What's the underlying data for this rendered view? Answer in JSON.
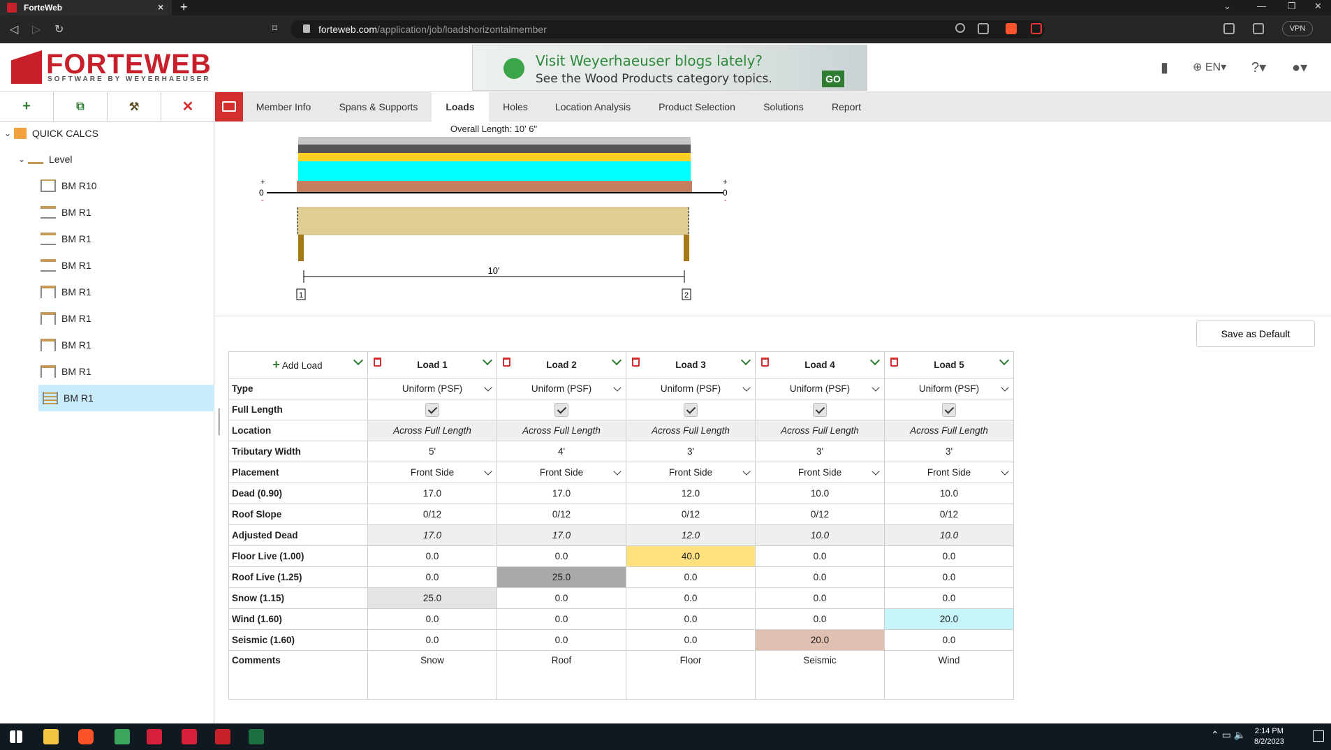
{
  "browser": {
    "tab_title": "ForteWeb",
    "url_domain": "forteweb.com",
    "url_path": "/application/job/loadshorizontalmember",
    "vpn_label": "VPN"
  },
  "header": {
    "logo_text": "FORTEWEB",
    "logo_sub": "SOFTWARE BY WEYERHAEUSER",
    "banner_line1": "Visit Weyerhaeuser blogs lately?",
    "banner_line2": "See the Wood Products category topics.",
    "banner_go": "GO",
    "lang": "EN"
  },
  "tree": {
    "root": "QUICK CALCS",
    "level": "Level",
    "items": [
      "BM R10",
      "BM R1",
      "BM R1",
      "BM R1",
      "BM R1",
      "BM R1",
      "BM R1",
      "BM R1",
      "BM R1"
    ]
  },
  "tabs": [
    "Member Info",
    "Spans & Supports",
    "Loads",
    "Holes",
    "Location Analysis",
    "Product Selection",
    "Solutions",
    "Report"
  ],
  "active_tab": "Loads",
  "diagram": {
    "overall_length": "Overall Length: 10' 6\"",
    "span_label": "10'",
    "support_1": "1",
    "support_2": "2",
    "zero_left": "0",
    "zero_right": "0",
    "plus": "+",
    "minus": "-",
    "load_bar_colors": [
      "#c6c6c6",
      "#555555",
      "#ffd024",
      "#00ffff",
      "#c4805e"
    ]
  },
  "save_default": "Save as Default",
  "grid": {
    "add_load": "Add Load",
    "loads": [
      "Load 1",
      "Load 2",
      "Load 3",
      "Load 4",
      "Load 5"
    ],
    "rows": {
      "type": {
        "label": "Type",
        "values": [
          "Uniform (PSF)",
          "Uniform (PSF)",
          "Uniform (PSF)",
          "Uniform (PSF)",
          "Uniform (PSF)"
        ]
      },
      "full_length": {
        "label": "Full Length"
      },
      "location": {
        "label": "Location",
        "values": [
          "Across Full Length",
          "Across Full Length",
          "Across Full Length",
          "Across Full Length",
          "Across Full Length"
        ]
      },
      "trib": {
        "label": "Tributary Width",
        "values": [
          "5'",
          "4'",
          "3'",
          "3'",
          "3'"
        ]
      },
      "placement": {
        "label": "Placement",
        "values": [
          "Front Side",
          "Front Side",
          "Front Side",
          "Front Side",
          "Front Side"
        ]
      },
      "dead": {
        "label": "Dead (0.90)",
        "values": [
          "17.0",
          "17.0",
          "12.0",
          "10.0",
          "10.0"
        ]
      },
      "roof_slope": {
        "label": "Roof Slope",
        "values": [
          "0/12",
          "0/12",
          "0/12",
          "0/12",
          "0/12"
        ]
      },
      "adj_dead": {
        "label": "Adjusted Dead",
        "values": [
          "17.0",
          "17.0",
          "12.0",
          "10.0",
          "10.0"
        ]
      },
      "floor_live": {
        "label": "Floor Live (1.00)",
        "values": [
          "0.0",
          "0.0",
          "40.0",
          "0.0",
          "0.0"
        ]
      },
      "roof_live": {
        "label": "Roof Live (1.25)",
        "values": [
          "0.0",
          "25.0",
          "0.0",
          "0.0",
          "0.0"
        ]
      },
      "snow": {
        "label": "Snow (1.15)",
        "values": [
          "25.0",
          "0.0",
          "0.0",
          "0.0",
          "0.0"
        ]
      },
      "wind": {
        "label": "Wind (1.60)",
        "values": [
          "0.0",
          "0.0",
          "0.0",
          "0.0",
          "20.0"
        ]
      },
      "seismic": {
        "label": "Seismic (1.60)",
        "values": [
          "0.0",
          "0.0",
          "0.0",
          "20.0",
          "0.0"
        ]
      },
      "comments": {
        "label": "Comments",
        "values": [
          "Snow",
          "Roof",
          "Floor",
          "Seismic",
          "Wind"
        ]
      }
    }
  },
  "taskbar": {
    "time": "2:14 PM",
    "date": "8/2/2023"
  }
}
